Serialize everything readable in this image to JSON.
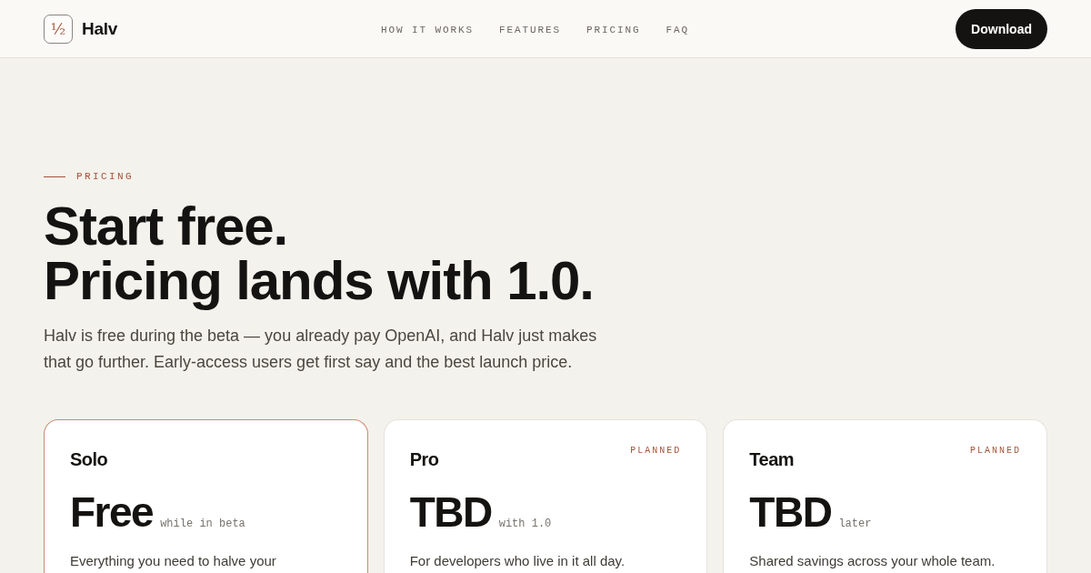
{
  "header": {
    "logo_mark": "½",
    "brand": "Halv",
    "nav": [
      "HOW IT WORKS",
      "FEATURES",
      "PRICING",
      "FAQ"
    ],
    "cta": "Download"
  },
  "hero": {
    "eyebrow": "PRICING",
    "heading_lines": [
      "Start free.",
      "Pricing lands with 1.0."
    ],
    "lead": "Halv is free during the beta — you already pay OpenAI, and Halv just makes that go further. Early-access users get first say and the best launch price."
  },
  "plans": [
    {
      "name": "Solo",
      "featured": true,
      "price": "Free",
      "price_note": "while in beta",
      "description": "Everything you need to halve your"
    },
    {
      "name": "Pro",
      "featured": false,
      "badge": "PLANNED",
      "price": "TBD",
      "price_note": "with 1.0",
      "description": "For developers who live in it all day."
    },
    {
      "name": "Team",
      "featured": false,
      "badge": "PLANNED",
      "price": "TBD",
      "price_note": "later",
      "description": "Shared savings across your whole team."
    }
  ]
}
